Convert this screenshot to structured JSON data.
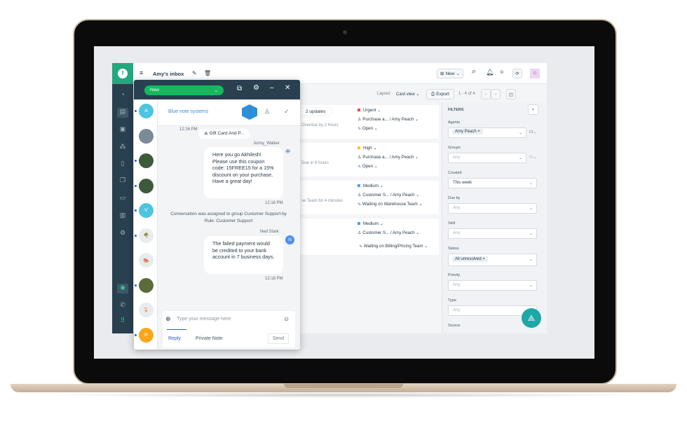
{
  "app": {
    "inbox_title": "Amy's inbox",
    "new_button": "New",
    "avatar_initial": "D",
    "brand_color": "#22a87e"
  },
  "nav": {
    "items": [
      "dashboard-icon",
      "tickets-icon",
      "contacts-icon",
      "groups-icon",
      "book-icon",
      "chat-icon",
      "archive-icon",
      "reports-icon",
      "settings-icon",
      "freshchat-icon",
      "phone-icon",
      "apps-icon"
    ]
  },
  "toolbar": {
    "layout_label": "Layout:",
    "layout_value": "Card view",
    "export_label": "Export",
    "pagination": "1 - 4 of 4"
  },
  "cards": [
    {
      "badge": "2 updates",
      "sub": "Overdue by 2 hours",
      "priority": "Urgent",
      "priority_color": "#f24949",
      "assignee": "Purchase a... / Amy Peach",
      "status": "Open"
    },
    {
      "badge": "",
      "sub": "Due in 6 hours",
      "priority": "High",
      "priority_color": "#f7c325",
      "assignee": "Purchase a... / Amy Peach",
      "status": "Open"
    },
    {
      "badge": "",
      "sub": "se Team for 4 minutes",
      "priority": "Medium",
      "priority_color": "#4d9cf8",
      "assignee": "Customer S... / Amy Peach",
      "status": "Waiting on Warehouse Team"
    },
    {
      "badge": "",
      "sub": "",
      "priority": "Medium",
      "priority_color": "#4d9cf8",
      "assignee": "Customer S... / Amy Peach",
      "status": "Waiting on Billing/Pricing Team"
    }
  ],
  "filters": {
    "title": "FILTERS",
    "agents_label": "Agents",
    "agents_chip": "Amy Peach",
    "groups_label": "Groups",
    "groups_value": "Any",
    "created_label": "Created",
    "created_value": "This week",
    "dueby_label": "Due by",
    "dueby_value": "Any",
    "skill_label": "Skill",
    "skill_value": "Any",
    "status_label": "Status",
    "status_chip": "All unresolved",
    "priority_label": "Priority",
    "priority_value": "Any",
    "type_label": "Type",
    "type_value": "Any",
    "source_label": "Source"
  },
  "chat": {
    "status": "New",
    "contact": "Blue note systems",
    "conversations": [
      {
        "initial": "A",
        "color": "#4dc4e0",
        "unread": true
      },
      {
        "initial": "",
        "color": "#7a8a99",
        "unread": false
      },
      {
        "initial": "",
        "color": "#3d5a3b",
        "unread": true
      },
      {
        "initial": "",
        "color": "#3d5a3b",
        "unread": true
      },
      {
        "initial": "V",
        "color": "#4dc4e0",
        "unread": true
      },
      {
        "initial": "🌴",
        "color": "#e8ecef",
        "unread": true
      },
      {
        "initial": "🍉",
        "color": "#e8ecef",
        "unread": false
      },
      {
        "initial": "",
        "color": "#5b6b3a",
        "unread": true
      },
      {
        "initial": "🍹",
        "color": "#e8ecef",
        "unread": false
      },
      {
        "initial": "R",
        "color": "#f9a61a",
        "unread": true
      }
    ],
    "messages": [
      {
        "time_top": "12:16 PM",
        "event": "Gift Card And P...",
        "author": "Jonny_Walker",
        "text": "Here you go Akhilesh! Please use this coupon code: 15FREE15 for a 15% discount on your purchase. Have a great day!",
        "time": "12:16 PM"
      },
      {
        "system": "Conversation was assigned to group Customer Support by Rule: Customer Support"
      },
      {
        "author": "Ned Stark",
        "author_initial": "N",
        "text": "The failed payment would be credited to your bank account in 7 business days.",
        "time": "12:18 PM"
      }
    ],
    "compose_placeholder": "Type your message here",
    "reply_tab": "Reply",
    "private_tab": "Private Note",
    "send_label": "Send"
  }
}
